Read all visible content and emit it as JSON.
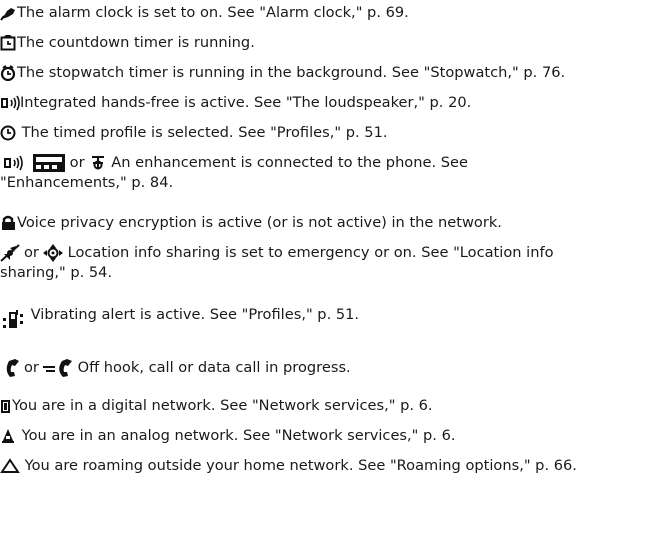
{
  "items": [
    {
      "icon": "alarm-clock-icon",
      "text": "The alarm clock is set to on. See \"Alarm clock,\" p. 69."
    },
    {
      "icon": "countdown-timer-icon",
      "text": "The countdown timer is running."
    },
    {
      "icon": "stopwatch-icon",
      "text": "The stopwatch timer is running in the background. See \"Stopwatch,\" p. 76."
    },
    {
      "icon": "loudspeaker-icon",
      "text": "Integrated hands-free is active. See \"The loudspeaker,\" p. 20."
    },
    {
      "icon": "timed-profile-icon",
      "text": "The timed profile is selected. See \"Profiles,\" p. 51."
    },
    {
      "icon": "enhancement-icons",
      "or1": "or",
      "text_line1": "An enhancement is connected to the phone. See",
      "text_line2": "\"Enhancements,\" p. 84."
    },
    {
      "icon": "lock-icon",
      "text": "Voice privacy encryption is active (or is not active) in the network."
    },
    {
      "icon": "location-icons",
      "or1": "or",
      "text_line1": "Location info sharing is set to emergency or on. See \"Location info",
      "text_line2": "sharing,\" p. 54."
    },
    {
      "icon": "vibrating-alert-icon",
      "text": "Vibrating alert is active. See \"Profiles,\" p. 51."
    },
    {
      "icon": "call-handset-icons",
      "or1": "or",
      "text": "Off hook, call or data call in progress."
    },
    {
      "icon": "digital-network-icon",
      "text": "You are in a digital network. See \"Network services,\" p. 6."
    },
    {
      "icon": "analog-network-icon",
      "text": "You are in an analog network. See \"Network services,\" p. 6."
    },
    {
      "icon": "roaming-icon",
      "text": "You are roaming outside your home network. See \"Roaming options,\" p. 66."
    }
  ]
}
